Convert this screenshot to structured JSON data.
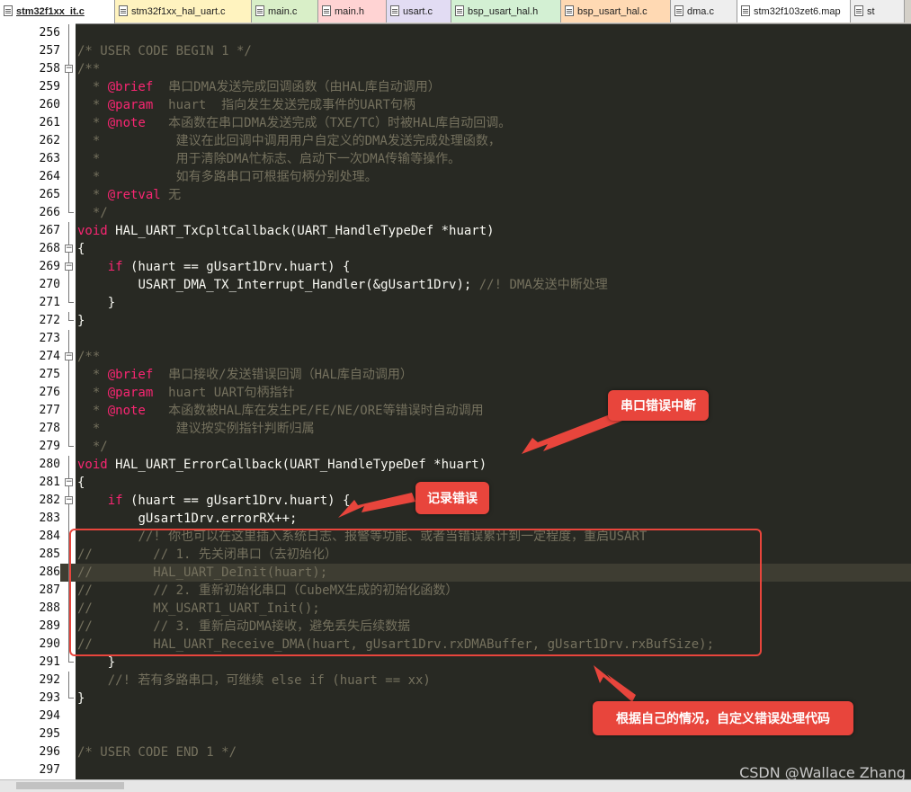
{
  "tabs": [
    {
      "label": "stm32f1xx_it.c",
      "active": true
    },
    {
      "label": "stm32f1xx_hal_uart.c",
      "active": false
    },
    {
      "label": "main.c",
      "active": false
    },
    {
      "label": "main.h",
      "active": false
    },
    {
      "label": "usart.c",
      "active": false
    },
    {
      "label": "bsp_usart_hal.h",
      "active": false
    },
    {
      "label": "bsp_usart_hal.c",
      "active": false
    },
    {
      "label": "dma.c",
      "active": false
    },
    {
      "label": "stm32f103zet6.map",
      "active": false
    },
    {
      "label": "st",
      "active": false
    }
  ],
  "lines": [
    {
      "n": "256",
      "fold": "line",
      "segs": []
    },
    {
      "n": "257",
      "fold": "line",
      "segs": [
        [
          "c",
          "/* USER CODE BEGIN 1 */"
        ]
      ]
    },
    {
      "n": "258",
      "fold": "box",
      "segs": [
        [
          "c",
          "/**"
        ]
      ]
    },
    {
      "n": "259",
      "fold": "line",
      "segs": [
        [
          "d",
          "  "
        ],
        [
          "c",
          "* "
        ],
        [
          "k",
          "@brief"
        ],
        [
          "c",
          "  串口DMA发送完成回调函数（由HAL库自动调用）"
        ]
      ]
    },
    {
      "n": "260",
      "fold": "line",
      "segs": [
        [
          "d",
          "  "
        ],
        [
          "c",
          "* "
        ],
        [
          "k",
          "@param"
        ],
        [
          "c",
          "  huart  指向发生发送完成事件的UART句柄"
        ]
      ]
    },
    {
      "n": "261",
      "fold": "line",
      "segs": [
        [
          "d",
          "  "
        ],
        [
          "c",
          "* "
        ],
        [
          "k",
          "@note"
        ],
        [
          "c",
          "   本函数在串口DMA发送完成（TXE/TC）时被HAL库自动回调。"
        ]
      ]
    },
    {
      "n": "262",
      "fold": "line",
      "segs": [
        [
          "d",
          "  "
        ],
        [
          "c",
          "*          建议在此回调中调用用户自定义的DMA发送完成处理函数，"
        ]
      ]
    },
    {
      "n": "263",
      "fold": "line",
      "segs": [
        [
          "d",
          "  "
        ],
        [
          "c",
          "*          用于清除DMA忙标志、启动下一次DMA传输等操作。"
        ]
      ]
    },
    {
      "n": "264",
      "fold": "line",
      "segs": [
        [
          "d",
          "  "
        ],
        [
          "c",
          "*          如有多路串口可根据句柄分别处理。"
        ]
      ]
    },
    {
      "n": "265",
      "fold": "line",
      "segs": [
        [
          "d",
          "  "
        ],
        [
          "c",
          "* "
        ],
        [
          "k",
          "@retval"
        ],
        [
          "c",
          " 无"
        ]
      ]
    },
    {
      "n": "266",
      "fold": "end",
      "segs": [
        [
          "d",
          "  "
        ],
        [
          "c",
          "*/"
        ]
      ]
    },
    {
      "n": "267",
      "fold": "line",
      "segs": [
        [
          "k",
          "void"
        ],
        [
          "p",
          " HAL_UART_TxCpltCallback(UART_HandleTypeDef *huart)"
        ]
      ]
    },
    {
      "n": "268",
      "fold": "box",
      "segs": [
        [
          "p",
          "{"
        ]
      ]
    },
    {
      "n": "269",
      "fold": "box",
      "segs": [
        [
          "d",
          "    "
        ],
        [
          "k",
          "if"
        ],
        [
          "p",
          " (huart == gUsart1Drv.huart) {"
        ]
      ]
    },
    {
      "n": "270",
      "fold": "line",
      "segs": [
        [
          "d",
          "        "
        ],
        [
          "p",
          "USART_DMA_TX_Interrupt_Handler(&gUsart1Drv); "
        ],
        [
          "c",
          "//! DMA发送中断处理"
        ]
      ]
    },
    {
      "n": "271",
      "fold": "end",
      "segs": [
        [
          "d",
          "    "
        ],
        [
          "p",
          "}"
        ]
      ]
    },
    {
      "n": "272",
      "fold": "end",
      "segs": [
        [
          "p",
          "}"
        ]
      ]
    },
    {
      "n": "273",
      "fold": "line",
      "segs": []
    },
    {
      "n": "274",
      "fold": "box",
      "segs": [
        [
          "c",
          "/**"
        ]
      ]
    },
    {
      "n": "275",
      "fold": "line",
      "segs": [
        [
          "d",
          "  "
        ],
        [
          "c",
          "* "
        ],
        [
          "k",
          "@brief"
        ],
        [
          "c",
          "  串口接收/发送错误回调（HAL库自动调用）"
        ]
      ]
    },
    {
      "n": "276",
      "fold": "line",
      "segs": [
        [
          "d",
          "  "
        ],
        [
          "c",
          "* "
        ],
        [
          "k",
          "@param"
        ],
        [
          "c",
          "  huart UART句柄指针"
        ]
      ]
    },
    {
      "n": "277",
      "fold": "line",
      "segs": [
        [
          "d",
          "  "
        ],
        [
          "c",
          "* "
        ],
        [
          "k",
          "@note"
        ],
        [
          "c",
          "   本函数被HAL库在发生PE/FE/NE/ORE等错误时自动调用"
        ]
      ]
    },
    {
      "n": "278",
      "fold": "line",
      "segs": [
        [
          "d",
          "  "
        ],
        [
          "c",
          "*          建议按实例指针判断归属"
        ]
      ]
    },
    {
      "n": "279",
      "fold": "end",
      "segs": [
        [
          "d",
          "  "
        ],
        [
          "c",
          "*/"
        ]
      ]
    },
    {
      "n": "280",
      "fold": "line",
      "segs": [
        [
          "k",
          "void"
        ],
        [
          "p",
          " HAL_UART_ErrorCallback(UART_HandleTypeDef *huart)"
        ]
      ]
    },
    {
      "n": "281",
      "fold": "box",
      "segs": [
        [
          "p",
          "{"
        ]
      ]
    },
    {
      "n": "282",
      "fold": "box",
      "segs": [
        [
          "d",
          "    "
        ],
        [
          "k",
          "if"
        ],
        [
          "p",
          " (huart == gUsart1Drv.huart) {"
        ]
      ]
    },
    {
      "n": "283",
      "fold": "line",
      "segs": [
        [
          "d",
          "        "
        ],
        [
          "p",
          "gUsart1Drv.errorRX++;"
        ]
      ]
    },
    {
      "n": "284",
      "fold": "line",
      "segs": [
        [
          "d",
          "        "
        ],
        [
          "c",
          "//! 你也可以在这里插入系统日志、报警等功能、或者当错误累计到一定程度，重启USART"
        ]
      ]
    },
    {
      "n": "285",
      "fold": "line",
      "segs": [
        [
          "c",
          "//        // 1. 先关闭串口（去初始化）"
        ]
      ]
    },
    {
      "n": "286",
      "fold": "line",
      "cur": true,
      "segs": [
        [
          "c",
          "//        HAL_UART_DeInit(huart);"
        ]
      ]
    },
    {
      "n": "287",
      "fold": "line",
      "segs": [
        [
          "c",
          "//        // 2. 重新初始化串口（CubeMX生成的初始化函数）"
        ]
      ]
    },
    {
      "n": "288",
      "fold": "line",
      "segs": [
        [
          "c",
          "//        MX_USART1_UART_Init();"
        ]
      ]
    },
    {
      "n": "289",
      "fold": "line",
      "segs": [
        [
          "c",
          "//        // 3. 重新启动DMA接收，避免丢失后续数据"
        ]
      ]
    },
    {
      "n": "290",
      "fold": "line",
      "segs": [
        [
          "c",
          "//        HAL_UART_Receive_DMA(huart, gUsart1Drv.rxDMABuffer, gUsart1Drv.rxBufSize);"
        ]
      ]
    },
    {
      "n": "291",
      "fold": "end",
      "segs": [
        [
          "d",
          "    "
        ],
        [
          "p",
          "}"
        ]
      ]
    },
    {
      "n": "292",
      "fold": "line",
      "segs": [
        [
          "d",
          "    "
        ],
        [
          "c",
          "//! 若有多路串口，可继续 else if (huart == xx)"
        ]
      ]
    },
    {
      "n": "293",
      "fold": "end",
      "segs": [
        [
          "p",
          "}"
        ]
      ]
    },
    {
      "n": "294",
      "fold": "none",
      "segs": []
    },
    {
      "n": "295",
      "fold": "none",
      "segs": []
    },
    {
      "n": "296",
      "fold": "none",
      "segs": [
        [
          "c",
          "/* USER CODE END 1 */"
        ]
      ]
    },
    {
      "n": "297",
      "fold": "none",
      "segs": []
    }
  ],
  "annotations": {
    "uart_error_interrupt": "串口错误中断",
    "record_error": "记录错误",
    "custom_handling": "根据自己的情况，自定义错误处理代码"
  },
  "watermark": "CSDN @Wallace Zhang",
  "colors": {
    "accent": "#e8453c",
    "editor_bg": "#282923",
    "keyword": "#f92672",
    "comment": "#75715e"
  }
}
